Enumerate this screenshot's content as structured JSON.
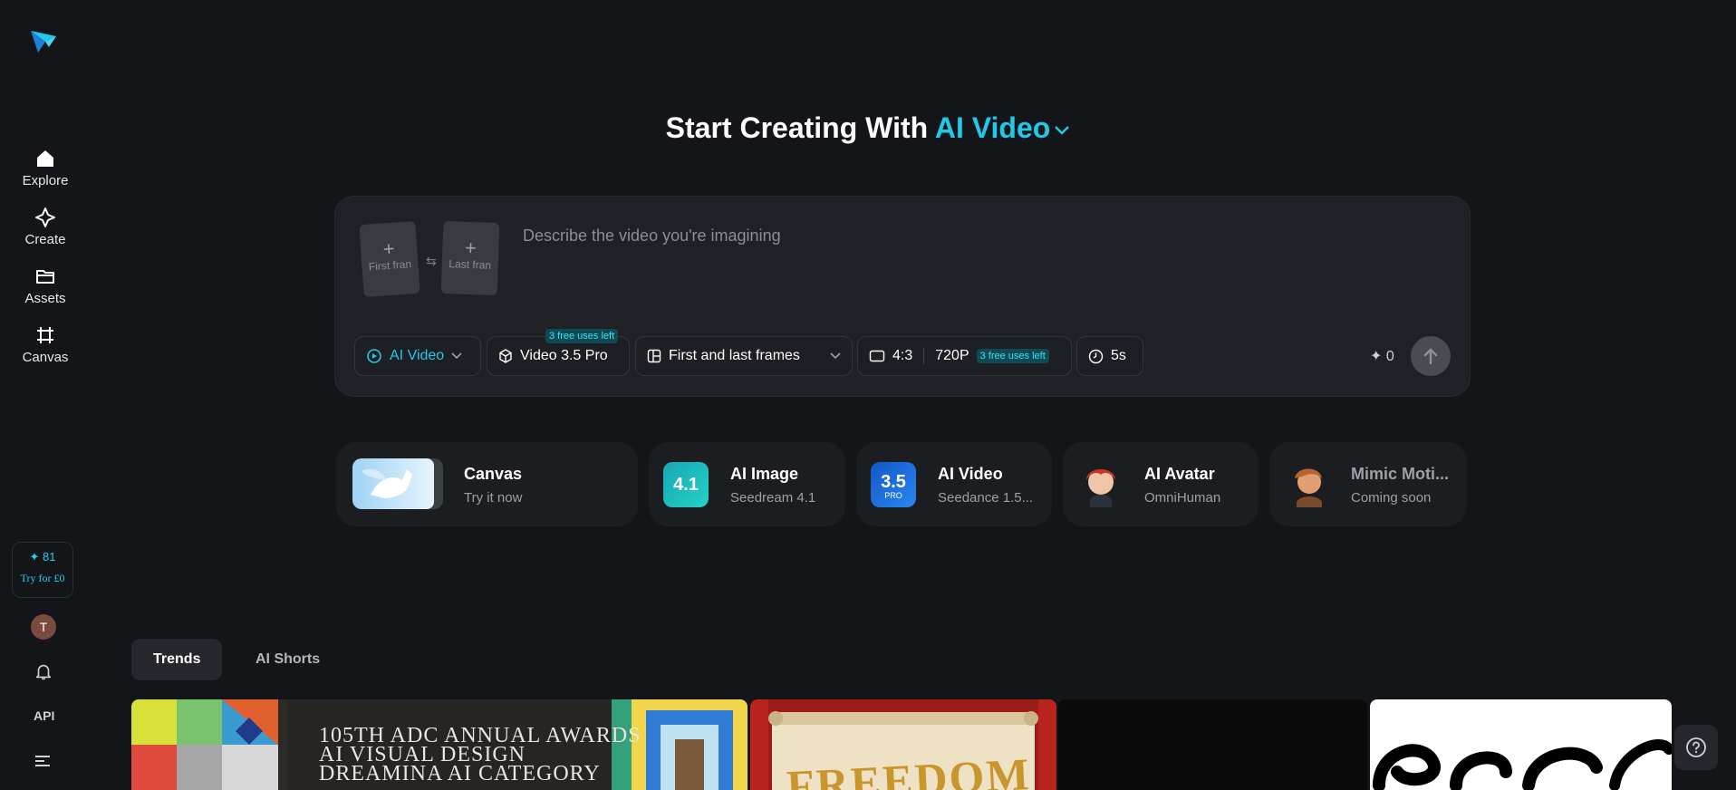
{
  "heading": {
    "prefix": "Start Creating With",
    "mode": "AI Video"
  },
  "sidebar": {
    "items": [
      {
        "label": "Explore"
      },
      {
        "label": "Create"
      },
      {
        "label": "Assets"
      },
      {
        "label": "Canvas"
      }
    ],
    "credits": "81",
    "try_label": "Try for £0",
    "avatar_initial": "T",
    "api_label": "API"
  },
  "prompt": {
    "placeholder": "Describe the video you're imagining",
    "value": "",
    "first_frame_label": "First fran",
    "last_frame_label": "Last fran"
  },
  "toolbar": {
    "mode_label": "AI Video",
    "model_label": "Video 3.5 Pro",
    "model_badge": "3 free uses left",
    "frames_label": "First and last frames",
    "ratio_label": "4:3",
    "resolution_label": "720P",
    "resolution_badge": "3 free uses left",
    "duration_label": "5s",
    "cost": "0"
  },
  "features": [
    {
      "title": "Canvas",
      "subtitle": "Try it now"
    },
    {
      "title": "AI Image",
      "subtitle": "Seedream 4.1",
      "badge": "4.1"
    },
    {
      "title": "AI Video",
      "subtitle": "Seedance 1.5...",
      "badge": "3.5",
      "badge_sub": "PRO"
    },
    {
      "title": "AI Avatar",
      "subtitle": "OmniHuman"
    },
    {
      "title": "Mimic Moti...",
      "subtitle": "Coming soon"
    }
  ],
  "tabs": [
    {
      "label": "Trends"
    },
    {
      "label": "AI Shorts"
    }
  ],
  "gallery": {
    "adc_line1": "105TH ADC ANNUAL AWARDS",
    "adc_line2": "AI VISUAL DESIGN",
    "adc_line3": "DREAMINA AI CATEGORY",
    "freedom": "FREEDOM"
  },
  "colors": {
    "accent": "#22c8e8",
    "background": "#141518",
    "panel": "#202126"
  }
}
